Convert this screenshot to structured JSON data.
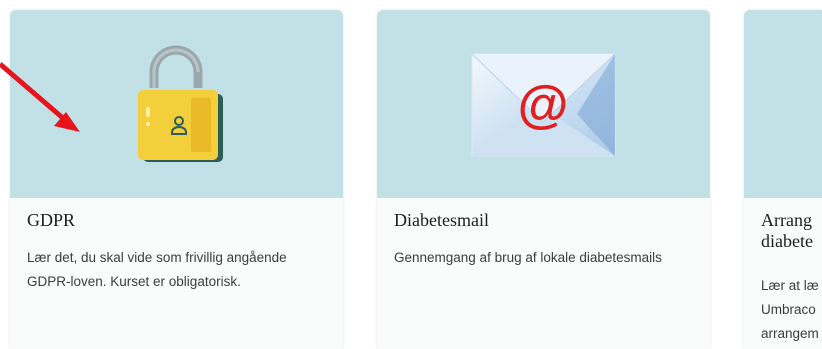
{
  "cards": [
    {
      "icon": "padlock-icon",
      "title": "GDPR",
      "description": "Lær det, du skal vide som frivillig angående GDPR-loven. Kurset er obligatorisk."
    },
    {
      "icon": "email-envelope-icon",
      "icon_symbol": "@",
      "title": "Diabetesmail",
      "description": "Gennemgang af brug af lokale diabetesmails"
    },
    {
      "icon": "unknown",
      "title": "Arrang diabete",
      "description": "Lær at læ Umbraco arrangem"
    }
  ],
  "annotation": {
    "icon": "red-arrow-icon",
    "color": "#e8141c"
  },
  "colors": {
    "image_background": "#c2e1e6",
    "padlock_body": "#f3cf3b",
    "padlock_shackle": "#9aa8ad",
    "envelope_symbol": "#e02020"
  }
}
